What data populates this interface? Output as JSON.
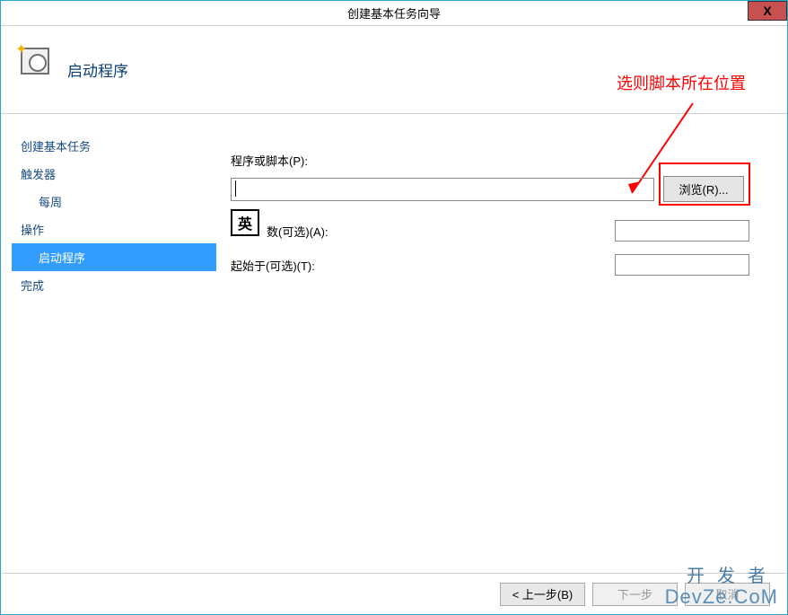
{
  "window": {
    "title": "创建基本任务向导",
    "close": "X"
  },
  "header": {
    "page_title": "启动程序"
  },
  "annotation": {
    "text": "选则脚本所在位置"
  },
  "sidebar": {
    "items": [
      {
        "label": "创建基本任务",
        "indent": false,
        "selected": false
      },
      {
        "label": "触发器",
        "indent": false,
        "selected": false
      },
      {
        "label": "每周",
        "indent": true,
        "selected": false
      },
      {
        "label": "操作",
        "indent": false,
        "selected": false
      },
      {
        "label": "启动程序",
        "indent": true,
        "selected": true
      },
      {
        "label": "完成",
        "indent": false,
        "selected": false
      }
    ]
  },
  "form": {
    "program_label": "程序或脚本(P):",
    "program_value": "",
    "browse_label": "浏览(R)...",
    "args_label": "数(可选)(A):",
    "args_value": "",
    "startin_label": "起始于(可选)(T):",
    "startin_value": "",
    "ime_badge": "英"
  },
  "footer": {
    "back": "< 上一步(B)",
    "next": "下一步",
    "cancel": "取消"
  },
  "watermark": {
    "line1": "开发者",
    "line2": "DevZe.CoM"
  }
}
